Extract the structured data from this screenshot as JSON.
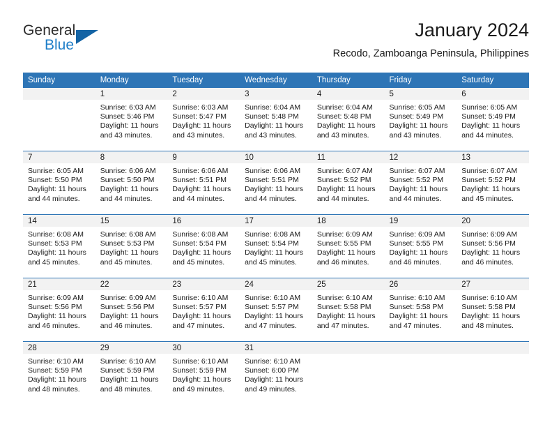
{
  "brand": {
    "name_part1": "General",
    "name_part2": "Blue"
  },
  "header": {
    "title": "January 2024",
    "subtitle": "Recodo, Zamboanga Peninsula, Philippines"
  },
  "colors": {
    "header_blue": "#2e75b6",
    "daynum_band": "#f2f2f2",
    "logo_blue": "#1e7ec8",
    "logo_flag": "#1464a5"
  },
  "weekday_headers": [
    "Sunday",
    "Monday",
    "Tuesday",
    "Wednesday",
    "Thursday",
    "Friday",
    "Saturday"
  ],
  "weeks": [
    [
      {
        "day": "",
        "line1": "",
        "line2": "",
        "line3": "",
        "line4": ""
      },
      {
        "day": "1",
        "line1": "Sunrise: 6:03 AM",
        "line2": "Sunset: 5:46 PM",
        "line3": "Daylight: 11 hours",
        "line4": "and 43 minutes."
      },
      {
        "day": "2",
        "line1": "Sunrise: 6:03 AM",
        "line2": "Sunset: 5:47 PM",
        "line3": "Daylight: 11 hours",
        "line4": "and 43 minutes."
      },
      {
        "day": "3",
        "line1": "Sunrise: 6:04 AM",
        "line2": "Sunset: 5:48 PM",
        "line3": "Daylight: 11 hours",
        "line4": "and 43 minutes."
      },
      {
        "day": "4",
        "line1": "Sunrise: 6:04 AM",
        "line2": "Sunset: 5:48 PM",
        "line3": "Daylight: 11 hours",
        "line4": "and 43 minutes."
      },
      {
        "day": "5",
        "line1": "Sunrise: 6:05 AM",
        "line2": "Sunset: 5:49 PM",
        "line3": "Daylight: 11 hours",
        "line4": "and 43 minutes."
      },
      {
        "day": "6",
        "line1": "Sunrise: 6:05 AM",
        "line2": "Sunset: 5:49 PM",
        "line3": "Daylight: 11 hours",
        "line4": "and 44 minutes."
      }
    ],
    [
      {
        "day": "7",
        "line1": "Sunrise: 6:05 AM",
        "line2": "Sunset: 5:50 PM",
        "line3": "Daylight: 11 hours",
        "line4": "and 44 minutes."
      },
      {
        "day": "8",
        "line1": "Sunrise: 6:06 AM",
        "line2": "Sunset: 5:50 PM",
        "line3": "Daylight: 11 hours",
        "line4": "and 44 minutes."
      },
      {
        "day": "9",
        "line1": "Sunrise: 6:06 AM",
        "line2": "Sunset: 5:51 PM",
        "line3": "Daylight: 11 hours",
        "line4": "and 44 minutes."
      },
      {
        "day": "10",
        "line1": "Sunrise: 6:06 AM",
        "line2": "Sunset: 5:51 PM",
        "line3": "Daylight: 11 hours",
        "line4": "and 44 minutes."
      },
      {
        "day": "11",
        "line1": "Sunrise: 6:07 AM",
        "line2": "Sunset: 5:52 PM",
        "line3": "Daylight: 11 hours",
        "line4": "and 44 minutes."
      },
      {
        "day": "12",
        "line1": "Sunrise: 6:07 AM",
        "line2": "Sunset: 5:52 PM",
        "line3": "Daylight: 11 hours",
        "line4": "and 44 minutes."
      },
      {
        "day": "13",
        "line1": "Sunrise: 6:07 AM",
        "line2": "Sunset: 5:52 PM",
        "line3": "Daylight: 11 hours",
        "line4": "and 45 minutes."
      }
    ],
    [
      {
        "day": "14",
        "line1": "Sunrise: 6:08 AM",
        "line2": "Sunset: 5:53 PM",
        "line3": "Daylight: 11 hours",
        "line4": "and 45 minutes."
      },
      {
        "day": "15",
        "line1": "Sunrise: 6:08 AM",
        "line2": "Sunset: 5:53 PM",
        "line3": "Daylight: 11 hours",
        "line4": "and 45 minutes."
      },
      {
        "day": "16",
        "line1": "Sunrise: 6:08 AM",
        "line2": "Sunset: 5:54 PM",
        "line3": "Daylight: 11 hours",
        "line4": "and 45 minutes."
      },
      {
        "day": "17",
        "line1": "Sunrise: 6:08 AM",
        "line2": "Sunset: 5:54 PM",
        "line3": "Daylight: 11 hours",
        "line4": "and 45 minutes."
      },
      {
        "day": "18",
        "line1": "Sunrise: 6:09 AM",
        "line2": "Sunset: 5:55 PM",
        "line3": "Daylight: 11 hours",
        "line4": "and 46 minutes."
      },
      {
        "day": "19",
        "line1": "Sunrise: 6:09 AM",
        "line2": "Sunset: 5:55 PM",
        "line3": "Daylight: 11 hours",
        "line4": "and 46 minutes."
      },
      {
        "day": "20",
        "line1": "Sunrise: 6:09 AM",
        "line2": "Sunset: 5:56 PM",
        "line3": "Daylight: 11 hours",
        "line4": "and 46 minutes."
      }
    ],
    [
      {
        "day": "21",
        "line1": "Sunrise: 6:09 AM",
        "line2": "Sunset: 5:56 PM",
        "line3": "Daylight: 11 hours",
        "line4": "and 46 minutes."
      },
      {
        "day": "22",
        "line1": "Sunrise: 6:09 AM",
        "line2": "Sunset: 5:56 PM",
        "line3": "Daylight: 11 hours",
        "line4": "and 46 minutes."
      },
      {
        "day": "23",
        "line1": "Sunrise: 6:10 AM",
        "line2": "Sunset: 5:57 PM",
        "line3": "Daylight: 11 hours",
        "line4": "and 47 minutes."
      },
      {
        "day": "24",
        "line1": "Sunrise: 6:10 AM",
        "line2": "Sunset: 5:57 PM",
        "line3": "Daylight: 11 hours",
        "line4": "and 47 minutes."
      },
      {
        "day": "25",
        "line1": "Sunrise: 6:10 AM",
        "line2": "Sunset: 5:58 PM",
        "line3": "Daylight: 11 hours",
        "line4": "and 47 minutes."
      },
      {
        "day": "26",
        "line1": "Sunrise: 6:10 AM",
        "line2": "Sunset: 5:58 PM",
        "line3": "Daylight: 11 hours",
        "line4": "and 47 minutes."
      },
      {
        "day": "27",
        "line1": "Sunrise: 6:10 AM",
        "line2": "Sunset: 5:58 PM",
        "line3": "Daylight: 11 hours",
        "line4": "and 48 minutes."
      }
    ],
    [
      {
        "day": "28",
        "line1": "Sunrise: 6:10 AM",
        "line2": "Sunset: 5:59 PM",
        "line3": "Daylight: 11 hours",
        "line4": "and 48 minutes."
      },
      {
        "day": "29",
        "line1": "Sunrise: 6:10 AM",
        "line2": "Sunset: 5:59 PM",
        "line3": "Daylight: 11 hours",
        "line4": "and 48 minutes."
      },
      {
        "day": "30",
        "line1": "Sunrise: 6:10 AM",
        "line2": "Sunset: 5:59 PM",
        "line3": "Daylight: 11 hours",
        "line4": "and 49 minutes."
      },
      {
        "day": "31",
        "line1": "Sunrise: 6:10 AM",
        "line2": "Sunset: 6:00 PM",
        "line3": "Daylight: 11 hours",
        "line4": "and 49 minutes."
      },
      {
        "day": "",
        "line1": "",
        "line2": "",
        "line3": "",
        "line4": ""
      },
      {
        "day": "",
        "line1": "",
        "line2": "",
        "line3": "",
        "line4": ""
      },
      {
        "day": "",
        "line1": "",
        "line2": "",
        "line3": "",
        "line4": ""
      }
    ]
  ]
}
